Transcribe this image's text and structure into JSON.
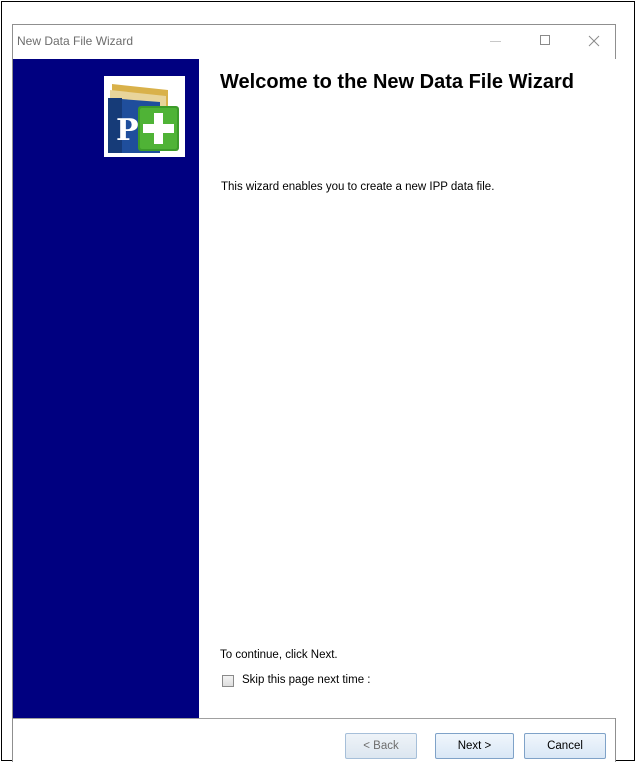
{
  "window": {
    "title": "New Data File Wizard"
  },
  "content": {
    "heading": "Welcome to the New Data File Wizard",
    "intro": "This wizard enables you to create a new IPP data file.",
    "continue_text": "To continue, click Next.",
    "skip_checkbox": {
      "label": "Skip this page next time :",
      "checked": false
    }
  },
  "buttons": {
    "back": "< Back",
    "next": "Next >",
    "cancel": "Cancel"
  },
  "colors": {
    "sidebar": "#000080",
    "logo_green": "#3c9b2a",
    "logo_blue": "#1f4e9c",
    "logo_gold": "#d9b14a"
  }
}
